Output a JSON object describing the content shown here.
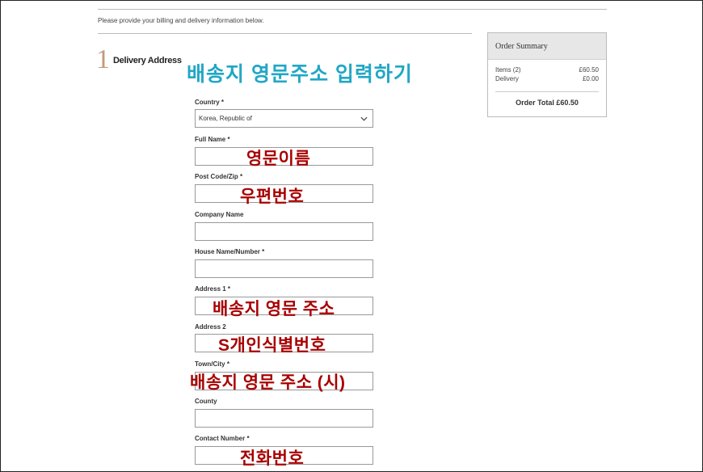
{
  "intro_text": "Please provide your billing and delivery information below.",
  "step": {
    "number": "1",
    "title": "Delivery Address"
  },
  "overlay_title": "배송지 영문주소 입력하기",
  "fields": {
    "country": {
      "label": "Country *",
      "value": "Korea, Republic of"
    },
    "full_name": {
      "label": "Full Name *",
      "overlay": "영문이름"
    },
    "postcode": {
      "label": "Post Code/Zip *",
      "overlay": "우편번호"
    },
    "company": {
      "label": "Company Name"
    },
    "house": {
      "label": "House Name/Number *"
    },
    "address1": {
      "label": "Address 1 *",
      "overlay": "배송지 영문 주소"
    },
    "address2": {
      "label": "Address 2",
      "overlay": "S개인식별번호"
    },
    "town": {
      "label": "Town/City *",
      "overlay": "배송지 영문 주소 (시)"
    },
    "county": {
      "label": "County"
    },
    "contact": {
      "label": "Contact Number *",
      "overlay": "전화번호"
    }
  },
  "summary": {
    "title": "Order Summary",
    "items_label": "Items (2)",
    "items_value": "£60.50",
    "delivery_label": "Delivery",
    "delivery_value": "£0.00",
    "total": "Order Total £60.50"
  },
  "colors": {
    "step_number": "#c59a7a",
    "overlay_title": "#21a7c6",
    "overlay_red": "#a80000"
  }
}
